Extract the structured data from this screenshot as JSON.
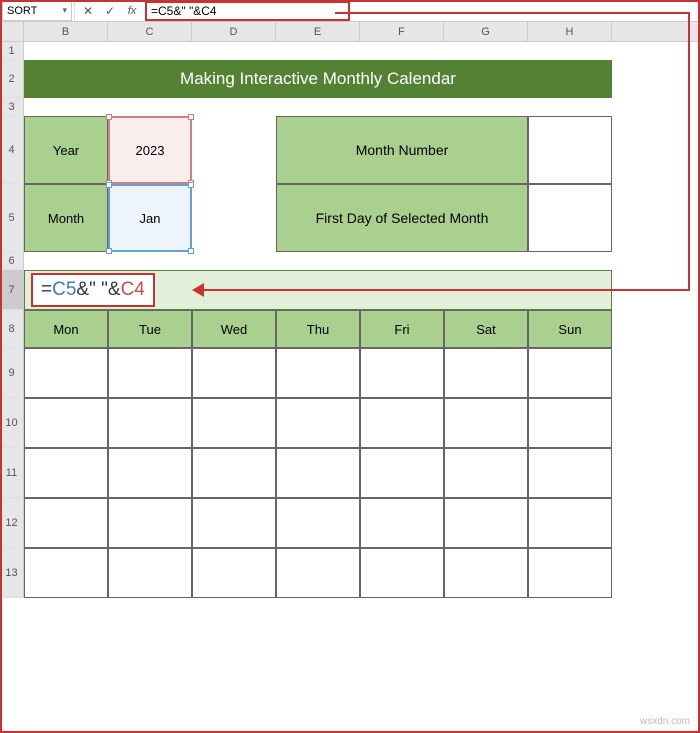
{
  "namebox": "SORT",
  "formula_bar": "=C5&\" \"&C4",
  "columns": [
    "B",
    "C",
    "D",
    "E",
    "F",
    "G",
    "H"
  ],
  "rows": [
    "1",
    "2",
    "3",
    "4",
    "5",
    "6",
    "7",
    "8",
    "9",
    "10",
    "11",
    "12",
    "13"
  ],
  "title": "Making Interactive Monthly Calendar",
  "inputs": {
    "year_label": "Year",
    "year_value": "2023",
    "month_label": "Month",
    "month_value": "Jan"
  },
  "right_labels": {
    "month_number": "Month Number",
    "first_day": "First Day of Selected Month"
  },
  "formula_parts": {
    "eq": "=",
    "c5": "C5",
    "amp1": "&",
    "str": "\" \"",
    "amp2": "&",
    "c4": "C4"
  },
  "days": [
    "Mon",
    "Tue",
    "Wed",
    "Thu",
    "Fri",
    "Sat",
    "Sun"
  ],
  "watermark": "wsxdn.com",
  "icons": {
    "cancel": "✕",
    "confirm": "✓",
    "fx": "fx",
    "dropdown": "▾"
  }
}
